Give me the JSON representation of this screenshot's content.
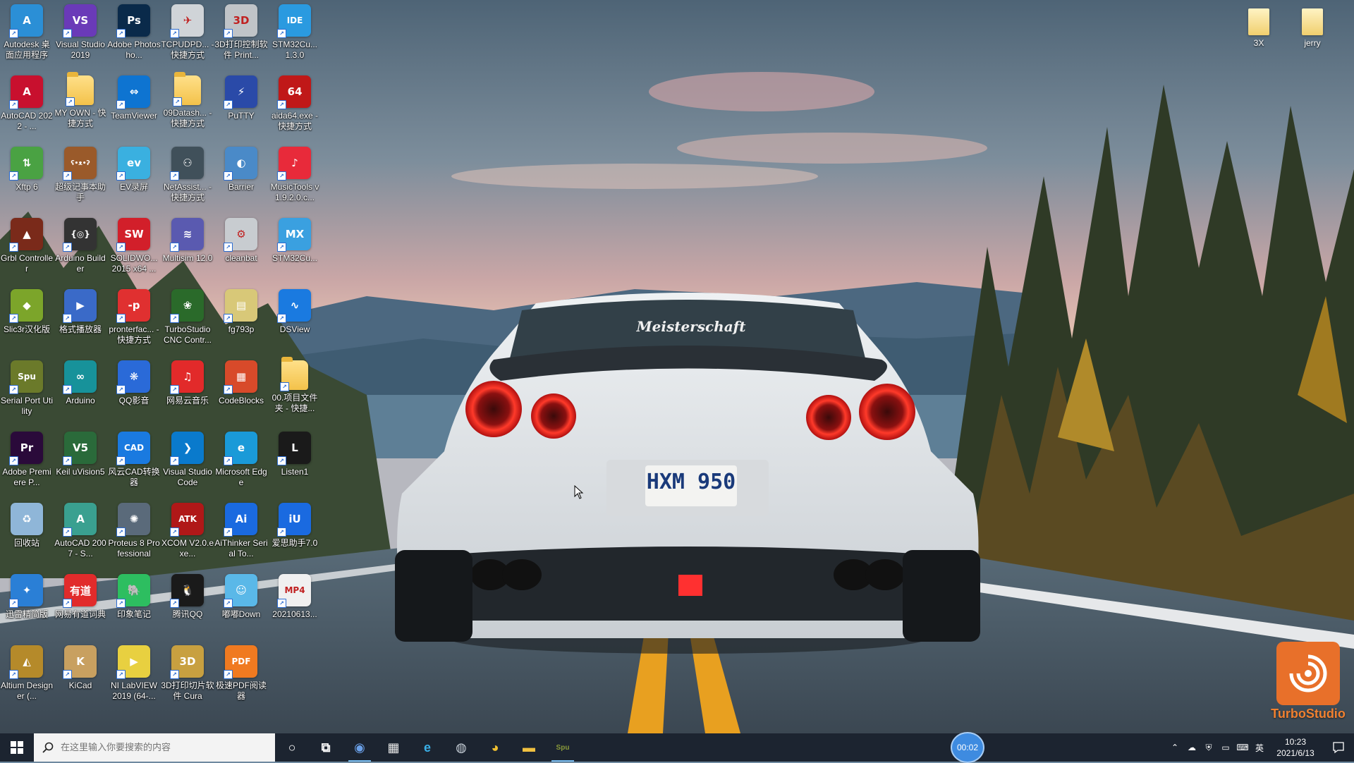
{
  "desktop": {
    "columns": [
      [
        {
          "label": "Autodesk 桌面应用程序",
          "icon": "autodesk-icon",
          "glyph": "A",
          "color": "#2b8fd6",
          "shortcut": true
        },
        {
          "label": "AutoCAD 2022 - ...",
          "icon": "autocad-icon",
          "glyph": "A",
          "color": "#c8102e",
          "shortcut": true
        },
        {
          "label": "Xftp 6",
          "icon": "xftp-icon",
          "glyph": "⇅",
          "color": "#4aa243",
          "shortcut": true
        },
        {
          "label": "Grbl Controller",
          "icon": "grbl-controller-icon",
          "glyph": "▲",
          "color": "#7a2a1a",
          "shortcut": true
        },
        {
          "label": "Slic3r汉化版",
          "icon": "slic3r-icon",
          "glyph": "◆",
          "color": "#7ca52a",
          "shortcut": true
        },
        {
          "label": "Serial Port Utility",
          "icon": "serial-port-utility-icon",
          "glyph": "Spu",
          "color": "#6b7a2a",
          "shortcut": true
        },
        {
          "label": "Adobe Premiere P...",
          "icon": "premiere-icon",
          "glyph": "Pr",
          "color": "#2a0a3a",
          "shortcut": true
        },
        {
          "label": "回收站",
          "icon": "recycle-bin-icon",
          "glyph": "♻",
          "color": "#8fb6d8",
          "shortcut": false
        },
        {
          "label": "迅雷精简版",
          "icon": "xunlei-icon",
          "glyph": "✦",
          "color": "#2a7fd6",
          "shortcut": true
        },
        {
          "label": "Altium Designer (...",
          "icon": "altium-icon",
          "glyph": "◭",
          "color": "#b58a2a",
          "shortcut": true
        }
      ],
      [
        {
          "label": "Visual Studio 2019",
          "icon": "visual-studio-icon",
          "glyph": "VS",
          "color": "#6a3ab8",
          "shortcut": true
        },
        {
          "label": "MY OWN - 快捷方式",
          "icon": "folder-icon",
          "glyph": "",
          "color": "folder",
          "shortcut": true
        },
        {
          "label": "超级记事本助手",
          "icon": "bear-app-icon",
          "glyph": "ʕ•ᴥ•ʔ",
          "color": "#9a5a2a",
          "shortcut": true
        },
        {
          "label": "Arduino Builder",
          "icon": "arduino-builder-icon",
          "glyph": "{◎}",
          "color": "#333333",
          "shortcut": true
        },
        {
          "label": "格式播放器",
          "icon": "video-player-icon",
          "glyph": "▶",
          "color": "#3a6ac8",
          "shortcut": true
        },
        {
          "label": "Arduino",
          "icon": "arduino-icon",
          "glyph": "∞",
          "color": "#17929a",
          "shortcut": true
        },
        {
          "label": "Keil uVision5",
          "icon": "keil-icon",
          "glyph": "V5",
          "color": "#2a6a3a",
          "shortcut": true
        },
        {
          "label": "AutoCAD 2007 - S...",
          "icon": "autocad-2007-icon",
          "glyph": "A",
          "color": "#3aa090",
          "shortcut": true
        },
        {
          "label": "网易有道词典",
          "icon": "youdao-icon",
          "glyph": "有道",
          "color": "#e12b2b",
          "shortcut": true
        },
        {
          "label": "KiCad",
          "icon": "kicad-icon",
          "glyph": "K",
          "color": "#c8a060",
          "shortcut": true
        }
      ],
      [
        {
          "label": "Adobe Photosho...",
          "icon": "photoshop-icon",
          "glyph": "Ps",
          "color": "#0a2a4a",
          "shortcut": true
        },
        {
          "label": "TeamViewer",
          "icon": "teamviewer-icon",
          "glyph": "⇔",
          "color": "#0e74d1",
          "shortcut": true
        },
        {
          "label": "EV录屏",
          "icon": "ev-recorder-icon",
          "glyph": "ev",
          "color": "#3ab0e0",
          "shortcut": true
        },
        {
          "label": "SOLIDWO... 2015 x64 ...",
          "icon": "solidworks-icon",
          "glyph": "SW",
          "color": "#d21f2a",
          "shortcut": true
        },
        {
          "label": "pronterfac... - 快捷方式",
          "icon": "pronterface-icon",
          "glyph": "-p",
          "color": "#e03030",
          "shortcut": true
        },
        {
          "label": "QQ影音",
          "icon": "qq-player-icon",
          "glyph": "❋",
          "color": "#2a6ad8",
          "shortcut": true
        },
        {
          "label": "风云CAD转换器",
          "icon": "cad-converter-icon",
          "glyph": "CAD",
          "color": "#1a7ae0",
          "shortcut": true
        },
        {
          "label": "Proteus 8 Professional",
          "icon": "proteus-icon",
          "glyph": "✺",
          "color": "#5a6a7a",
          "shortcut": true
        },
        {
          "label": "印象笔记",
          "icon": "evernote-icon",
          "glyph": "🐘",
          "color": "#2dbe60",
          "shortcut": true
        },
        {
          "label": "NI LabVIEW 2019 (64-...",
          "icon": "labview-icon",
          "glyph": "▶",
          "color": "#e8d040",
          "shortcut": true
        }
      ],
      [
        {
          "label": "TCPUDPD... - 快捷方式",
          "icon": "tcpudp-icon",
          "glyph": "✈",
          "color": "#d0d4d8",
          "shortcut": true
        },
        {
          "label": "09Datash... - 快捷方式",
          "icon": "folder-icon",
          "glyph": "",
          "color": "folder",
          "shortcut": true
        },
        {
          "label": "NetAssist... - 快捷方式",
          "icon": "netassist-icon",
          "glyph": "⚇",
          "color": "#40505a",
          "shortcut": true
        },
        {
          "label": "Multisim 12.0",
          "icon": "multisim-icon",
          "glyph": "≋",
          "color": "#5a5ab0",
          "shortcut": true
        },
        {
          "label": "TurboStudio CNC Contr...",
          "icon": "turbostudio-cnc-icon",
          "glyph": "❀",
          "color": "#2a6a2a",
          "shortcut": true
        },
        {
          "label": "网易云音乐",
          "icon": "netease-music-icon",
          "glyph": "♫",
          "color": "#e22a2a",
          "shortcut": true
        },
        {
          "label": "Visual Studio Code",
          "icon": "vscode-icon",
          "glyph": "❯",
          "color": "#0a7acc",
          "shortcut": true
        },
        {
          "label": "XCOM V2.0.exe...",
          "icon": "xcom-icon",
          "glyph": "ATK",
          "color": "#b01818",
          "shortcut": true
        },
        {
          "label": "腾讯QQ",
          "icon": "qq-icon",
          "glyph": "🐧",
          "color": "#1a1a1a",
          "shortcut": true
        },
        {
          "label": "3D打印切片软件 Cura",
          "icon": "cura-icon",
          "glyph": "3D",
          "color": "#c8a040",
          "shortcut": true
        }
      ],
      [
        {
          "label": "3D打印控制软件 Print...",
          "icon": "3d-print-icon",
          "glyph": "3D",
          "color": "#c0c4c8",
          "shortcut": true
        },
        {
          "label": "PuTTY",
          "icon": "putty-icon",
          "glyph": "⚡",
          "color": "#2a4aa8",
          "shortcut": true
        },
        {
          "label": "Barrier",
          "icon": "barrier-icon",
          "glyph": "◐",
          "color": "#4a8ac8",
          "shortcut": true
        },
        {
          "label": "cleanbat",
          "icon": "cleanbat-icon",
          "glyph": "⚙",
          "color": "#c8ccd0",
          "shortcut": true
        },
        {
          "label": "fg793p",
          "icon": "fg793p-icon",
          "glyph": "▤",
          "color": "#d8c878",
          "shortcut": true
        },
        {
          "label": "CodeBlocks",
          "icon": "codeblocks-icon",
          "glyph": "▦",
          "color": "#d84a2a",
          "shortcut": true
        },
        {
          "label": "Microsoft Edge",
          "icon": "edge-icon",
          "glyph": "e",
          "color": "#1a9ad8",
          "shortcut": true
        },
        {
          "label": "AiThinker Serial To...",
          "icon": "aithinker-icon",
          "glyph": "Ai",
          "color": "#1a6ae0",
          "shortcut": true
        },
        {
          "label": "嘟嘟Down",
          "icon": "dudu-down-icon",
          "glyph": "☺",
          "color": "#5ab8e8",
          "shortcut": true
        },
        {
          "label": "极速PDF阅读器",
          "icon": "pdf-reader-icon",
          "glyph": "PDF",
          "color": "#f07a20",
          "shortcut": true
        }
      ],
      [
        {
          "label": "STM32Cu... 1.3.0",
          "icon": "stm32cube-ide-icon",
          "glyph": "IDE",
          "color": "#2a9ae0",
          "shortcut": true
        },
        {
          "label": "aida64.exe - 快捷方式",
          "icon": "aida64-icon",
          "glyph": "64",
          "color": "#c01818",
          "shortcut": true
        },
        {
          "label": "MusicTools v1.9.2.0.c...",
          "icon": "musictools-icon",
          "glyph": "♪",
          "color": "#e82a3a",
          "shortcut": true
        },
        {
          "label": "STM32Cu...",
          "icon": "stm32cube-mx-icon",
          "glyph": "MX",
          "color": "#3aa0e0",
          "shortcut": true
        },
        {
          "label": "DSView",
          "icon": "dsview-icon",
          "glyph": "∿",
          "color": "#1a7ae0",
          "shortcut": true
        },
        {
          "label": "00.项目文件夹 - 快捷...",
          "icon": "folder-icon",
          "glyph": "",
          "color": "folder",
          "shortcut": true
        },
        {
          "label": "Listen1",
          "icon": "listen1-icon",
          "glyph": "L",
          "color": "#1a1a1a",
          "shortcut": true
        },
        {
          "label": "爱思助手7.0",
          "icon": "i4-assistant-icon",
          "glyph": "iU",
          "color": "#1a6ae0",
          "shortcut": true
        },
        {
          "label": "20210613...",
          "icon": "mp4-file-icon",
          "glyph": "MP4",
          "color": "#f0f0f0",
          "shortcut": true
        }
      ]
    ],
    "right_folders": [
      {
        "label": "3X",
        "icon": "folder-icon"
      },
      {
        "label": "jerry",
        "icon": "folder-icon"
      }
    ],
    "watermark": {
      "name": "TurboStudio"
    },
    "wallpaper": {
      "plate_text": "HXM 950",
      "banner_text": "Meisterschaft"
    }
  },
  "taskbar": {
    "search_placeholder": "在这里输入你要搜索的内容",
    "pinned": [
      {
        "name": "cortana-icon",
        "glyph": "○",
        "active": false
      },
      {
        "name": "task-view-icon",
        "glyph": "⧉",
        "active": false
      },
      {
        "name": "app-globe-icon",
        "glyph": "◉",
        "active": true
      },
      {
        "name": "calculator-icon",
        "glyph": "▦",
        "active": false
      },
      {
        "name": "edge-icon",
        "glyph": "e",
        "active": false
      },
      {
        "name": "chat-app-icon",
        "glyph": "◍",
        "active": false
      },
      {
        "name": "chrome-icon",
        "glyph": "◕",
        "active": false
      },
      {
        "name": "file-explorer-icon",
        "glyph": "▬",
        "active": false
      },
      {
        "name": "serial-utility-icon",
        "glyph": "Spu",
        "active": true
      }
    ],
    "recording_timer": "00:02",
    "tray": {
      "input_method": "英",
      "time": "10:23",
      "date": "2021/6/13"
    }
  },
  "colors": {
    "taskbar_bg": "#1c2430",
    "accent": "#76b9ed",
    "turbo_orange": "#e8702a"
  }
}
